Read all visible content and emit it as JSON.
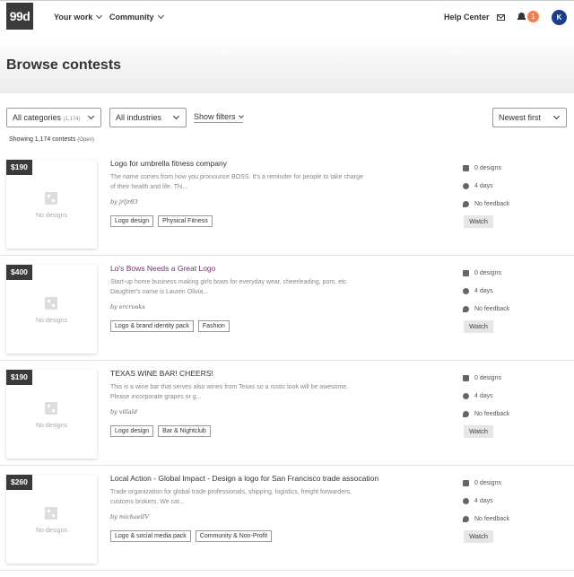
{
  "header": {
    "logo": "99d",
    "nav": [
      "Your work",
      "Community"
    ],
    "help": "Help Center",
    "notifications": "1",
    "avatar": "K"
  },
  "page": {
    "title": "Browse contests"
  },
  "filters": {
    "category_label": "All categories",
    "category_count": "(1,174)",
    "industry_label": "All industries",
    "show_filters": "Show filters",
    "sort_label": "Newest first"
  },
  "summary": {
    "text": "Showing 1,174 contests",
    "status": "(Open)"
  },
  "contests": [
    {
      "price": "$190",
      "no_designs": "No designs",
      "title": "Logo for umbrella fitness company",
      "description": "The name comes from how you pronounce BOSS. It's a reminder for people to take charge of their health and life. Thi...",
      "by": "by jrljr83",
      "tags": [
        "Logo design",
        "Physical Fitness"
      ],
      "designs": "0 designs",
      "days": "4 days",
      "feedback": "No feedback",
      "watch": "Watch"
    },
    {
      "price": "$400",
      "no_designs": "No designs",
      "title": "Lo's Bows Needs a Great Logo",
      "description": "Start-up home business making girls bows for everyday wear, cheerleading, pom, etc. Daughter's name is Lauren Olivia...",
      "by": "by ercrooks",
      "tags": [
        "Logo & brand identity pack",
        "Fashion"
      ],
      "designs": "0 designs",
      "days": "4 days",
      "feedback": "No feedback",
      "watch": "Watch"
    },
    {
      "price": "$190",
      "no_designs": "No designs",
      "title": "TEXAS WINE BAR! CHEERS!",
      "description": "This is a wine bar that serves also wines from Texas so a rustic look will be awesome. Please incorporate grapes or g...",
      "by": "by villald",
      "tags": [
        "Logo design",
        "Bar & Nightclub"
      ],
      "designs": "0 designs",
      "days": "4 days",
      "feedback": "No feedback",
      "watch": "Watch"
    },
    {
      "price": "$260",
      "no_designs": "No designs",
      "title": "Local Action - Global Impact - Design a logo for San Francisco trade assocation",
      "description": "Trade organization for global trade professionals, shipping, logistics, freight forwarders, customs brokers. We cat...",
      "by": "by michaelIV",
      "tags": [
        "Logo & social media pack",
        "Community & Non-Profit"
      ],
      "designs": "0 designs",
      "days": "4 days",
      "feedback": "No feedback",
      "watch": "Watch"
    }
  ]
}
